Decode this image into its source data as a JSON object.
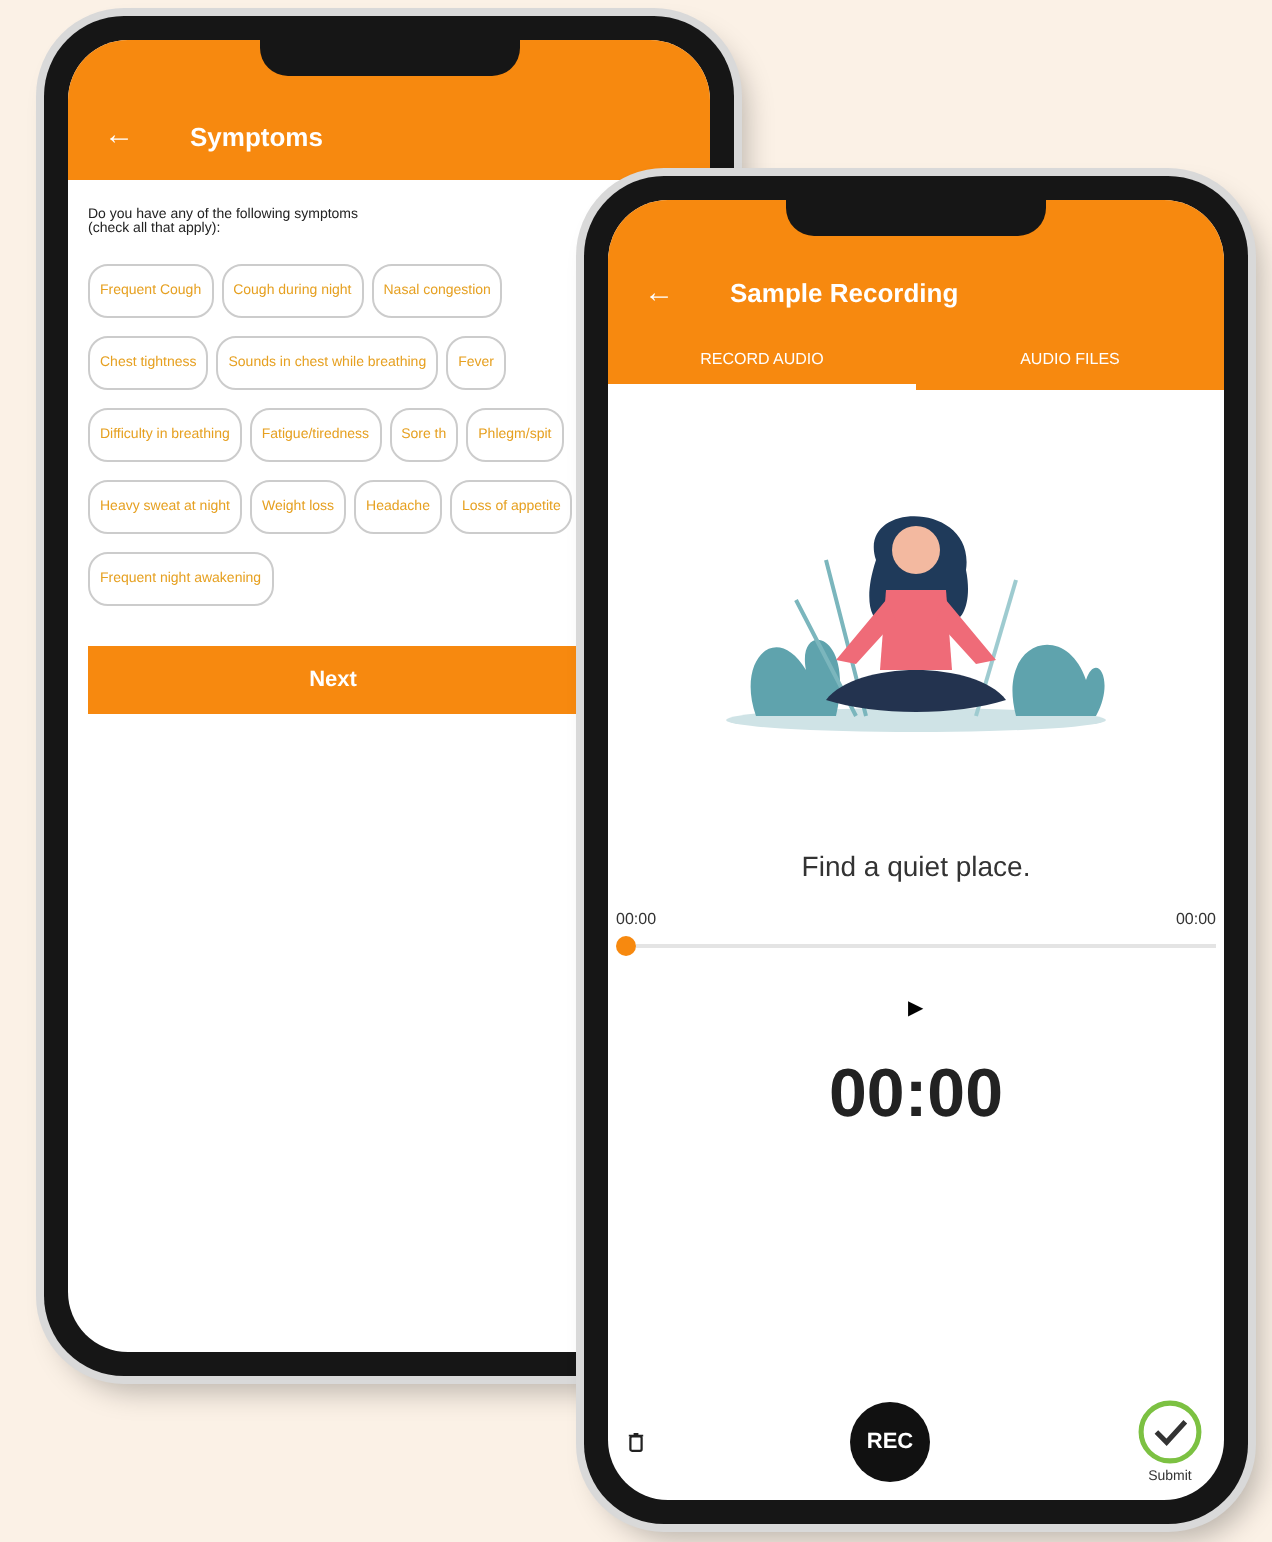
{
  "symptoms_screen": {
    "back": "←",
    "title": "Symptoms",
    "prompt": "Do you have any of the following symptoms\n(check all that apply):",
    "options": [
      "Frequent Cough",
      "Cough during night",
      "Nasal congestion",
      "Chest tightness",
      "Sounds in chest while breathing",
      "Fever",
      "Difficulty in breathing",
      "Fatigue/tiredness",
      "Sore th",
      "Phlegm/spit",
      "Heavy sweat at night",
      "Weight loss",
      "Headache",
      "Loss of appetite",
      "Frequent night awakening"
    ],
    "next_button": "Next"
  },
  "recording_screen": {
    "back": "←",
    "title": "Sample Recording",
    "tabs": [
      {
        "label": "RECORD AUDIO",
        "selected": true
      },
      {
        "label": "AUDIO FILES",
        "selected": false
      }
    ],
    "instruction": "Find a quiet place.",
    "player": {
      "elapsed": "00:00",
      "total": "00:00",
      "level": 0,
      "play": "▶"
    },
    "timer": "00:00",
    "record_button": "REC",
    "submit_label": "Submit"
  }
}
